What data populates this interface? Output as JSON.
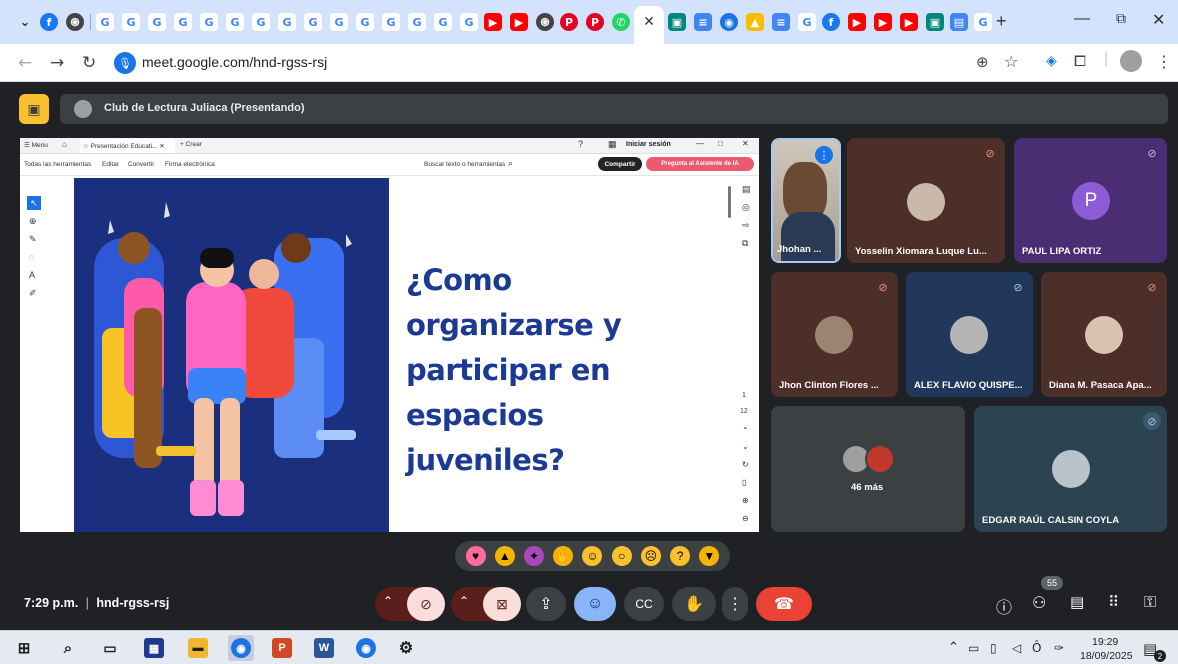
{
  "browser": {
    "url": "meet.google.com/hnd-rgss-rsj",
    "new_tab": "+",
    "tab_icons": [
      "chevron-down",
      "facebook",
      "openai",
      "google",
      "google",
      "google",
      "google",
      "google",
      "google",
      "google",
      "google",
      "google",
      "google",
      "google",
      "google",
      "google",
      "youtube",
      "youtube",
      "openai",
      "pinterest",
      "pinterest",
      "whatsapp",
      "close",
      "meet",
      "docs",
      "chrome",
      "drive",
      "docs",
      "google",
      "facebook",
      "youtube",
      "youtube",
      "youtube",
      "meet",
      "drive",
      "google"
    ]
  },
  "meet": {
    "presenter_banner": "Club de Lectura Juliaca (Presentando)",
    "time": "7:29 p.m.",
    "meeting_code": "hnd-rgss-rsj",
    "separator": "|",
    "people_count": "55",
    "more_count": "46 más",
    "participants": [
      {
        "name": "Jhohan ...",
        "muted": false
      },
      {
        "name": "Yosselin Xiomara Luque Lu...",
        "muted": true
      },
      {
        "name": "PAUL LIPA ORTIZ",
        "initial": "P",
        "muted": true
      },
      {
        "name": "Jhon Clinton Flores ...",
        "muted": true
      },
      {
        "name": "ALEX FLAVIO QUISPE...",
        "muted": true
      },
      {
        "name": "Diana M. Pasaca Apa...",
        "muted": true
      },
      {
        "name": "EDGAR RAÚL CALSIN COYLA",
        "muted": true
      }
    ]
  },
  "pdf": {
    "tab_label": "Presentación Educati...",
    "new_tab": "Crear",
    "menu": "Menu",
    "sign_in": "Iniciar sesión",
    "toolbar_items": [
      "Todas las herramientas",
      "Editar",
      "Convertir",
      "Firma electrónica"
    ],
    "search_placeholder": "Buscar texto o herramientas",
    "share_button": "Compartir",
    "ai_button": "Pregunta al Asistente de IA",
    "page_current": "1",
    "page_total": "12"
  },
  "slide": {
    "title": "¿Como organizarse y participar en espacios juveniles?"
  },
  "taskbar": {
    "time": "19:29",
    "date": "18/09/2025",
    "notification_count": "2"
  },
  "colors": {
    "meet_bg": "#202124",
    "end_call": "#ea4335",
    "mic_off": "#f9dedc",
    "slide_blue": "#1a2f7d",
    "slide_text": "#1c3a94",
    "active_blue": "#8ab4f8"
  }
}
